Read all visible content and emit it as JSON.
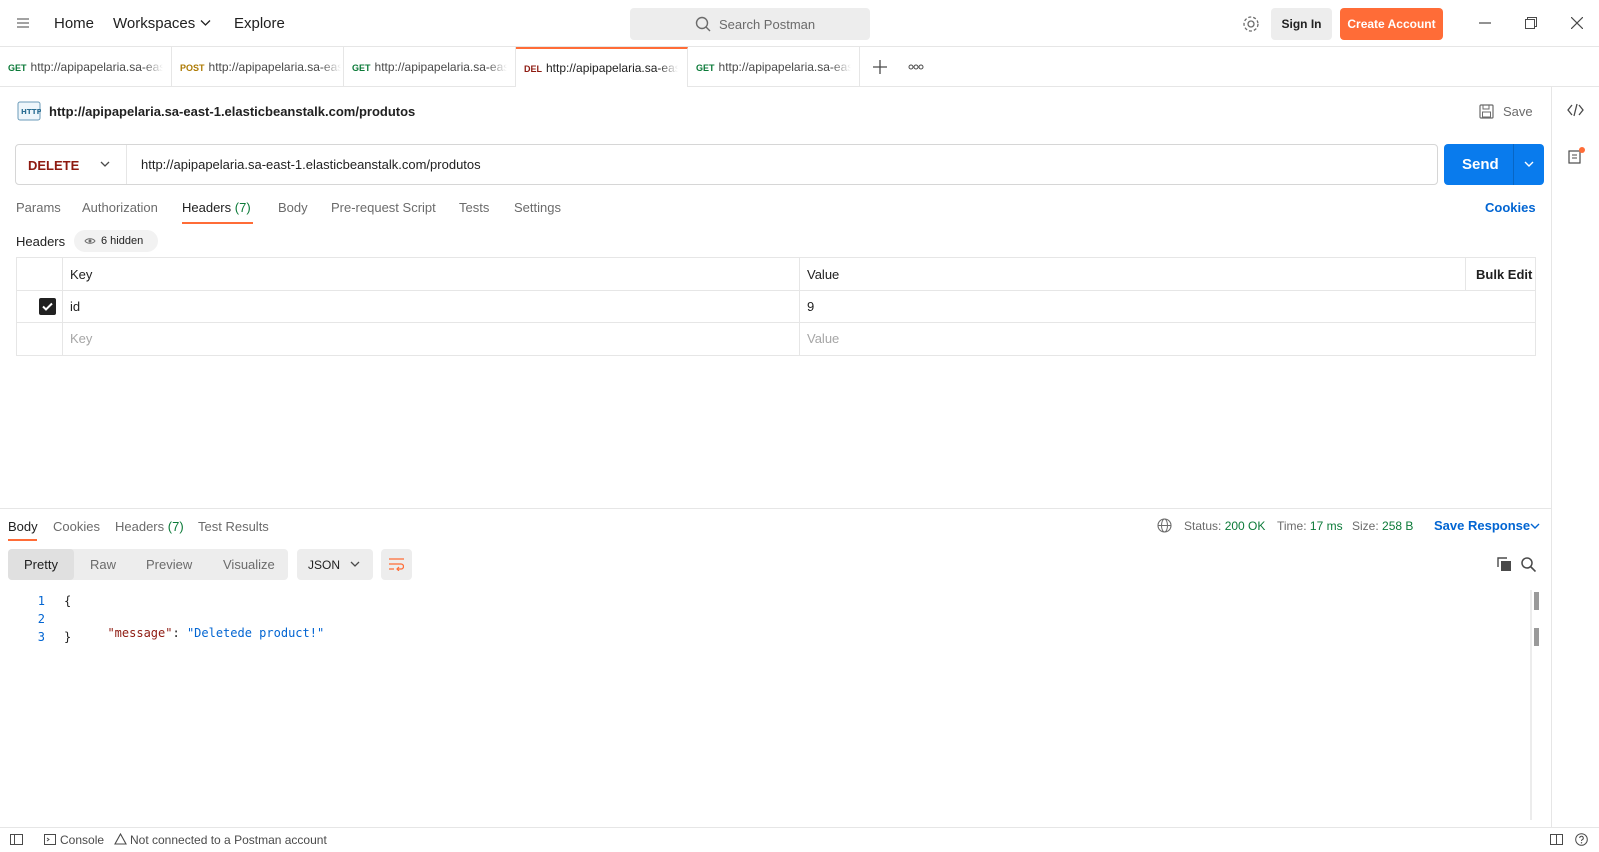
{
  "topbar": {
    "nav": [
      "Home",
      "Workspaces",
      "Explore"
    ],
    "search_placeholder": "Search Postman",
    "signin": "Sign In",
    "create_account": "Create Account"
  },
  "tabs": [
    {
      "method": "GET",
      "url": "http://apipapelaria.sa-east-1.elasticbeanstalk.com/produtos",
      "color": "#0b7a38",
      "active": false
    },
    {
      "method": "POST",
      "url": "http://apipapelaria.sa-east-1.elasticbeanstalk.com/produtos",
      "color": "#ad7a03",
      "active": false
    },
    {
      "method": "GET",
      "url": "http://apipapelaria.sa-east-1.elasticbeanstalk.com/produtos",
      "color": "#0b7a38",
      "active": false
    },
    {
      "method": "DEL",
      "url": "http://apipapelaria.sa-east-1.elasticbeanstalk.com/produtos",
      "color": "#8e1a10",
      "active": true
    },
    {
      "method": "GET",
      "url": "http://apipapelaria.sa-east-1.elasticbeanstalk.com/produtos",
      "color": "#0b7a38",
      "active": false
    }
  ],
  "request": {
    "title": "http://apipapelaria.sa-east-1.elasticbeanstalk.com/produtos",
    "save": "Save",
    "method": "DELETE",
    "url": "http://apipapelaria.sa-east-1.elasticbeanstalk.com/produtos",
    "send": "Send",
    "tabs": [
      "Params",
      "Authorization",
      "Headers",
      "Body",
      "Pre-request Script",
      "Tests",
      "Settings"
    ],
    "headers_count": "(7)",
    "cookies": "Cookies",
    "headers_label": "Headers",
    "hidden_label": "6 hidden",
    "table": {
      "key_header": "Key",
      "value_header": "Value",
      "bulk_edit": "Bulk Edit",
      "rows": [
        {
          "key": "id",
          "value": "9",
          "checked": true
        }
      ],
      "key_placeholder": "Key",
      "value_placeholder": "Value"
    }
  },
  "response": {
    "tabs": [
      "Body",
      "Cookies",
      "Headers",
      "Test Results"
    ],
    "headers_count": "(7)",
    "status_label": "Status:",
    "status_value": "200 OK",
    "time_label": "Time:",
    "time_value": "17 ms",
    "size_label": "Size:",
    "size_value": "258 B",
    "save_response": "Save Response",
    "views": [
      "Pretty",
      "Raw",
      "Preview",
      "Visualize"
    ],
    "format": "JSON",
    "body": {
      "line_numbers": [
        "1",
        "2",
        "3"
      ],
      "open": "{",
      "key": "\"message\"",
      "colon": ": ",
      "value": "\"Deletede product!\"",
      "close": "}"
    }
  },
  "footer": {
    "console": "Console",
    "status": "Not connected to a Postman account"
  },
  "colors": {
    "accent": "#ff6c37",
    "primary": "#097bed",
    "get": "#0b7a38",
    "post": "#ad7a03",
    "delete": "#8e1a10"
  }
}
